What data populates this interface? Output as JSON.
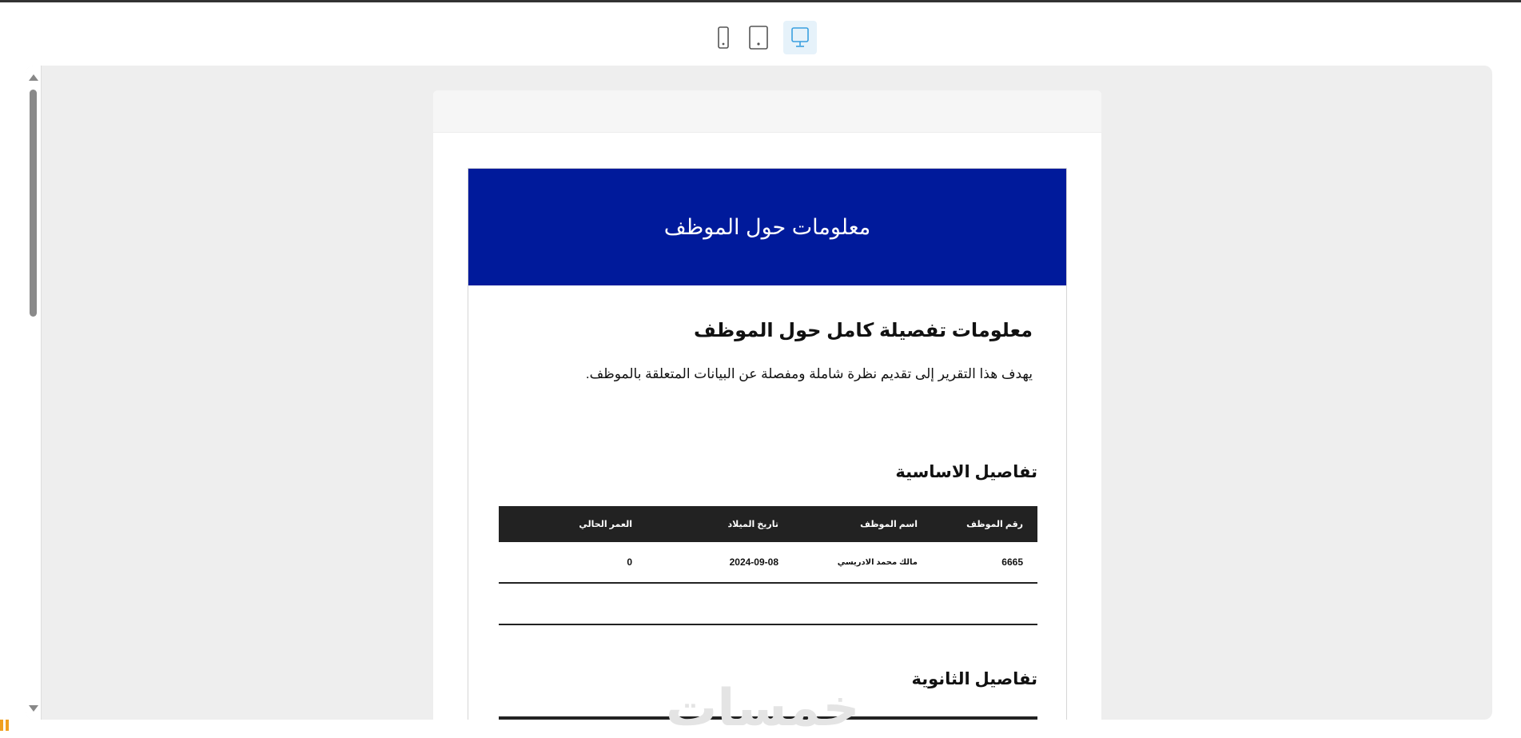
{
  "device_switcher": {
    "items": [
      {
        "name": "mobile",
        "icon": "mobile-phone-icon",
        "active": false
      },
      {
        "name": "tablet",
        "icon": "tablet-icon",
        "active": false
      },
      {
        "name": "desktop",
        "icon": "desktop-monitor-icon",
        "active": true
      }
    ],
    "active_color": "#3aa0e0"
  },
  "report": {
    "banner_title": "معلومات حول الموظف",
    "banner_color": "#001a9b",
    "title": "معلومات تفصيلة كامل حول الموظف",
    "description": "يهدف هذا التقرير إلى تقديم نظرة شاملة ومفصلة عن البيانات المتعلقة بالموظف.",
    "basic_section": {
      "title": "تفاصيل الاساسية",
      "headers": [
        "رقم الموظف",
        "اسم الموظف",
        "تاريخ الميلاد",
        "العمر الحالي"
      ],
      "rows": [
        [
          "6665",
          "مالك محمد الادريسي",
          "2024-09-08",
          "0"
        ]
      ]
    },
    "secondary_section": {
      "title": "تفاصيل الثانوية"
    }
  },
  "watermark": "خمسات"
}
